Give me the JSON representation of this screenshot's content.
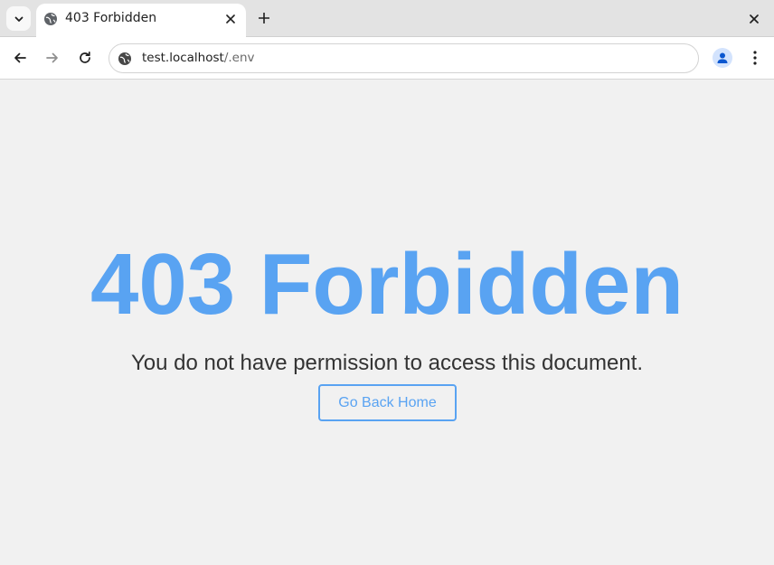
{
  "browser": {
    "tab": {
      "title": "403 Forbidden",
      "favicon": "globe-icon"
    },
    "url": {
      "host": "test.localhost",
      "path": "/.env"
    },
    "icons": {
      "tab_list": "chevron-down-icon",
      "tab_close": "close-icon",
      "new_tab": "plus-icon",
      "window_close": "close-icon",
      "back": "arrow-left-icon",
      "forward": "arrow-right-icon",
      "reload": "reload-icon",
      "site_info": "globe-icon",
      "profile": "person-icon",
      "menu": "kebab-menu-icon"
    }
  },
  "page": {
    "heading": "403 Forbidden",
    "message": "You do not have permission to access this document.",
    "home_button_label": "Go Back Home"
  },
  "colors": {
    "accent": "#59a3f2",
    "text": "#333333",
    "background": "#f1f1f1"
  }
}
